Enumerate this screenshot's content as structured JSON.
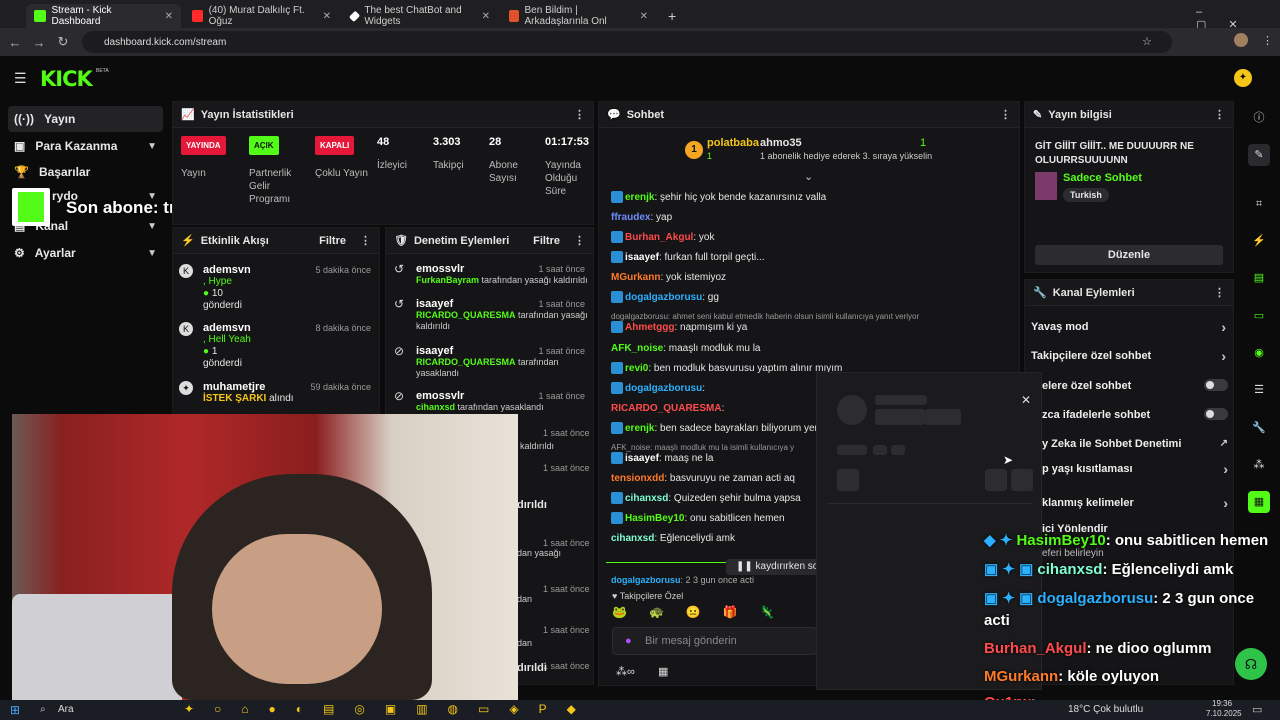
{
  "browser": {
    "tabs": [
      {
        "title": "Stream - Kick Dashboard",
        "color": "#53fc18"
      },
      {
        "title": "(40) Murat Dalkılıç Ft. Oğuz",
        "color": "#ff2b2b"
      },
      {
        "title": "The best ChatBot and Widgets",
        "color": "#ffffff"
      },
      {
        "title": "Ben Bildim | Arkadaşlarınla Onl",
        "color": "#e0502b"
      }
    ],
    "url": "dashboard.kick.com/stream"
  },
  "kick": {
    "logo": "KICK",
    "beta": "BETA"
  },
  "left_nav": {
    "items": [
      {
        "label": "Yayın"
      },
      {
        "label": "Para Kazanma"
      },
      {
        "label": "Başarılar"
      },
      {
        "label": "Kanal"
      },
      {
        "label": "Ayarlar"
      }
    ],
    "partial_label": "rydo"
  },
  "sub_overlay": {
    "text": "Son abone: trabzonluahmet"
  },
  "stats": {
    "title": "Yayın İstatistikleri",
    "cols": [
      {
        "badge": "YAYINDA",
        "label": "Yayın"
      },
      {
        "badge": "AÇIK",
        "label": "Partnerlik Gelir Programı"
      },
      {
        "badge": "KAPALI",
        "label": "Çoklu Yayın"
      },
      {
        "value": "48",
        "label": "İzleyici"
      },
      {
        "value": "3.303",
        "label": "Takipçi"
      },
      {
        "value": "28",
        "label": "Abone Sayısı"
      },
      {
        "value": "01:17:53",
        "label": "Yayında Olduğu Süre"
      }
    ]
  },
  "activity": {
    "title": "Etkinlik Akışı",
    "filter": "Filtre",
    "events": [
      {
        "user": "ademsvn",
        "time": "5 dakika önce",
        "line1": ", Hype",
        "amount": "10",
        "line2": "gönderdi"
      },
      {
        "user": "ademsvn",
        "time": "8 dakika önce",
        "line1": ", Hell Yeah",
        "amount": "1",
        "line2": "gönderdi"
      },
      {
        "user": "muhametjre",
        "time": "59 dakika önce",
        "line1": "İSTEK ŞARKI",
        "line2": "alındı"
      }
    ]
  },
  "moderation": {
    "title": "Denetim Eylemleri",
    "filter": "Filtre",
    "events": [
      {
        "user": "emossvlr",
        "time": "1 saat önce",
        "target": "FurkanBayram",
        "text": "tarafından yasağı kaldırıldı"
      },
      {
        "user": "isaayef",
        "time": "1 saat önce",
        "target": "RICARDO_QUARESMA",
        "text": "tarafından yasağı kaldırıldı"
      },
      {
        "user": "isaayef",
        "time": "1 saat önce",
        "target": "RICARDO_QUARESMA",
        "text": "tarafından yasaklandı"
      },
      {
        "user": "emossvlr",
        "time": "1 saat önce",
        "target": "cihanxsd",
        "text": "tarafından yasaklandı"
      }
    ],
    "times_partial": [
      "1 saat önce",
      "1 saat önce",
      "1 saat önce",
      "1 saat önce",
      "1 saat önce",
      "1 saat önce",
      "1 saat önce"
    ],
    "partial_texts": [
      "kaldırıldı",
      "dırıldı",
      "dan yasağı",
      "dan",
      "dan",
      "dırıldı"
    ]
  },
  "chat": {
    "title": "Sohbet",
    "top": {
      "user1": "polatbaba",
      "count1": "1",
      "user2": "ahmo35",
      "count2": "1",
      "gift_text": "1 abonelik hediye ederek 3. sıraya yükselin"
    },
    "messages": [
      {
        "user": "erenjk",
        "color": "#53fc18",
        "text": ": şehir hiç yok bende kazanırsınız valla"
      },
      {
        "user": "ffraudex",
        "color": "#6f8cff",
        "text": ": yap"
      },
      {
        "user": "Burhan_Akgul",
        "color": "#ff4b4b",
        "text": ": yok"
      },
      {
        "user": "isaayef",
        "color": "#ffffff",
        "text": ": furkan full torpil geçti..."
      },
      {
        "user": "MGurkann",
        "color": "#ff7a2b",
        "text": ": yok istemiyoz"
      },
      {
        "user": "dogalgazborusu",
        "color": "#2bb0ff",
        "text": ": gg"
      },
      {
        "user": "Ahmetggg",
        "color": "#ff4b4b",
        "text": ": napmışım ki ya",
        "reply": "dogalgazborusu: ahmet seni kabul etmedik haberin olsun isimli kullanıcıya yanıt veriyor"
      },
      {
        "user": "AFK_noise",
        "color": "#53fc18",
        "text": ": maaşlı modluk mu la"
      },
      {
        "user": "revi0",
        "color": "#53fc18",
        "text": ": ben modluk basvurusu yaptım alınır mıyım"
      },
      {
        "user": "dogalgazborusu",
        "color": "#2bb0ff",
        "text": ":"
      },
      {
        "user": "RICARDO_QUARESMA",
        "color": "#ff4b4b",
        "text": ":"
      },
      {
        "user": "erenjk",
        "color": "#53fc18",
        "text": ": ben sadece bayrakları biliyorum yer"
      },
      {
        "user": "isaayef",
        "color": "#ffffff",
        "text": ": maaş ne la",
        "reply": "AFK_noise: maaşlı modluk mu la isimli kullanıcıya y"
      },
      {
        "user": "tensionxdd",
        "color": "#ff7a2b",
        "text": ": basvuruyu ne zaman acti aq"
      },
      {
        "user": "cihanxsd",
        "color": "#7fffd4",
        "text": ": Quizeden şehir bulma yapsa"
      },
      {
        "user": "HasimBey10",
        "color": "#53fc18",
        "text": ": onu sabitlicen hemen"
      },
      {
        "user": "cihanxsd",
        "color": "#7fffd4",
        "text": ": Eğlenceliydi amk"
      }
    ],
    "paused": "kaydırırken soh",
    "last_partial": {
      "user": "dogalgazborusu",
      "text": ": 2 3 gun once acti"
    },
    "followers_only": "Takipçilere Özel",
    "input_placeholder": "Bir mesaj gönderin"
  },
  "stream_info": {
    "title": "Yayın bilgisi",
    "stream_title": "GİT GİİİT GİİİT.. ME DUUUURR NE OLUURRSUUUUNN",
    "category": "Sadece Sohbet",
    "tag": "Turkish",
    "edit": "Düzenle"
  },
  "channel_actions": {
    "title": "Kanal Eylemleri",
    "items": [
      {
        "label": "Yavaş mod",
        "kind": "chevron"
      },
      {
        "label": "Takipçilere özel sohbet",
        "kind": "chevron"
      },
      {
        "label": "elere özel sohbet",
        "kind": "toggle"
      },
      {
        "label": "zca ifadelerle sohbet",
        "kind": "toggle"
      },
      {
        "label": "y Zeka ile Sohbet Denetimi",
        "kind": "external"
      },
      {
        "label": "p yaşı kısıtlaması",
        "kind": "chevron"
      },
      {
        "label": "klanmış kelimeler",
        "kind": "chevron"
      },
      {
        "label": "ici Yönlendir",
        "kind": "none"
      },
      {
        "label": "eferi belirleyin",
        "kind": "none"
      }
    ]
  },
  "stream_overlay_chat": [
    {
      "user": "HasimBey10",
      "color": "#53fc18",
      "text": ": onu sabitlicen hemen"
    },
    {
      "user": "cihanxsd",
      "color": "#7fffd4",
      "text": ": Eğlenceliydi amk"
    },
    {
      "user": "dogalgazborusu",
      "color": "#2bb0ff",
      "text": ": 2 3 gun once"
    },
    {
      "user": "",
      "color": "#ffffff",
      "text": "acti"
    },
    {
      "user": "Burhan_Akgul",
      "color": "#ff4b4b",
      "text": ": ne dioo oglumm"
    },
    {
      "user": "MGurkann",
      "color": "#ff7a2b",
      "text": ": köle oyluyon"
    },
    {
      "user": "Ou1rw",
      "color": "#ff4b4b",
      "text": ":"
    }
  ],
  "taskbar": {
    "search": "Ara",
    "weather": "18°C  Çok bulutlu",
    "time": "19:36",
    "date": "7.10.2025"
  }
}
